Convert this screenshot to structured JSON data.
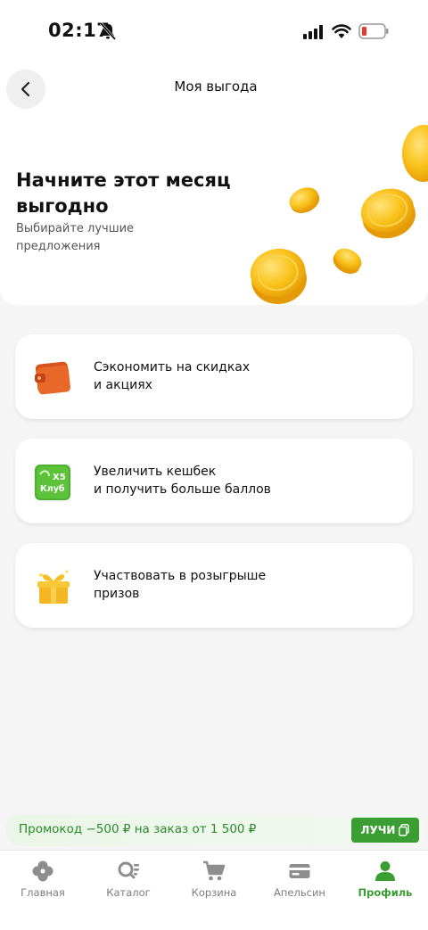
{
  "status_bar": {
    "time": "02:17"
  },
  "header": {
    "title": "Моя выгода",
    "hero_title": "Начните этот месяц выгодно",
    "hero_subtitle": "Выбирайте лучшие предложения"
  },
  "cards": [
    {
      "label_line1": "Сэкономить на скидках",
      "label_line2": "и акциях",
      "icon": "wallet-icon"
    },
    {
      "label_line1": "Увеличить кешбек",
      "label_line2": "и получить больше баллов",
      "icon": "x5-club-icon",
      "icon_text_1": "X5",
      "icon_text_2": "Клуб"
    },
    {
      "label_line1": "Участвовать в розыгрыше",
      "label_line2": "призов",
      "icon": "gift-icon"
    }
  ],
  "promo": {
    "text": "Промокод −500 ₽ на заказ от 1 500 ₽",
    "code": "ЛУЧИ"
  },
  "tabbar": {
    "items": [
      {
        "label": "Главная",
        "icon": "home-icon",
        "active": false
      },
      {
        "label": "Каталог",
        "icon": "catalog-icon",
        "active": false
      },
      {
        "label": "Корзина",
        "icon": "cart-icon",
        "active": false
      },
      {
        "label": "Апельсин",
        "icon": "card-icon",
        "active": false
      },
      {
        "label": "Профиль",
        "icon": "profile-icon",
        "active": true
      }
    ]
  },
  "colors": {
    "accent": "#3a9e32",
    "coin": "#f7b90f",
    "background": "#f5f5f5"
  }
}
